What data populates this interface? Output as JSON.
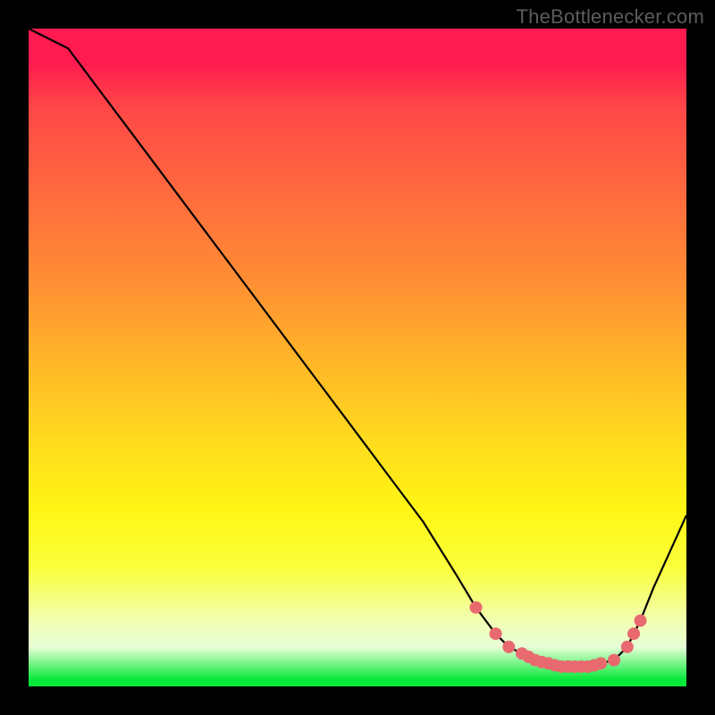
{
  "watermark": "TheBottlenecker.com",
  "colors": {
    "background": "#000000",
    "curve_stroke": "#000000",
    "marker_fill": "#e86a6f",
    "marker_stroke": "#e86a6f"
  },
  "chart_data": {
    "type": "line",
    "title": "",
    "xlabel": "",
    "ylabel": "",
    "xlim": [
      0,
      100
    ],
    "ylim": [
      0,
      100
    ],
    "series": [
      {
        "name": "bottleneck-curve",
        "x": [
          0,
          6,
          12,
          18,
          24,
          30,
          36,
          42,
          48,
          54,
          60,
          65,
          68,
          71,
          73,
          75,
          77,
          79,
          81,
          83,
          85,
          87,
          89,
          91,
          93,
          95,
          100
        ],
        "y": [
          100,
          97,
          89,
          81,
          73,
          65,
          57,
          49,
          41,
          33,
          25,
          17,
          12,
          8,
          6,
          5,
          4,
          3.5,
          3,
          3,
          3,
          3.5,
          4,
          6,
          10,
          15,
          26
        ]
      }
    ],
    "markers": {
      "name": "sweet-spot-points",
      "x": [
        68,
        71,
        73,
        75,
        76,
        77,
        78,
        79,
        80,
        81,
        82,
        83,
        84,
        85,
        86,
        87,
        89,
        91,
        92,
        93
      ],
      "y": [
        12,
        8,
        6,
        5,
        4.5,
        4,
        3.7,
        3.5,
        3.2,
        3,
        3,
        3,
        3,
        3,
        3.2,
        3.5,
        4,
        6,
        8,
        10
      ]
    }
  }
}
